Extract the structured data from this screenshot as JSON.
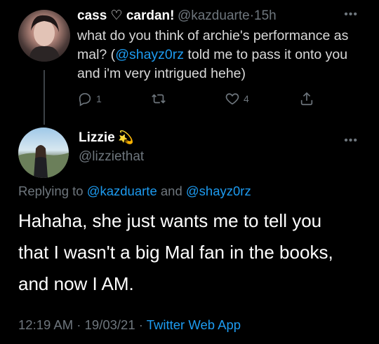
{
  "reply_parent": {
    "display_name": "cass ♡ cardan!",
    "handle": "@kazduarte",
    "separator": "·",
    "time": "15h",
    "text_before": "what do you think of archie's performance as mal? (",
    "mention": "@shayz0rz",
    "text_after": " told me to pass it onto you and i'm very intrigued hehe)",
    "reply_count": "1",
    "retweet_count": "",
    "like_count": "4"
  },
  "main_tweet": {
    "display_name": "Lizzie",
    "name_emoji": "💫",
    "handle": "@lizziethat",
    "replying_prefix": "Replying to ",
    "replying_user1": "@kazduarte",
    "replying_and": " and ",
    "replying_user2": "@shayz0rz",
    "text": "Hahaha, she just wants me to tell you that I wasn't a big Mal fan in the books, and now I AM.",
    "timestamp": "12:19 AM · 19/03/21 · ",
    "source": "Twitter Web App"
  },
  "icons": {
    "more": "more-horizontal-icon",
    "reply": "reply-icon",
    "retweet": "retweet-icon",
    "like": "heart-icon",
    "share": "share-icon"
  },
  "colors": {
    "background": "#000000",
    "accent": "#1d9bf0",
    "muted": "#6e767d",
    "text": "#d9d9d9"
  }
}
